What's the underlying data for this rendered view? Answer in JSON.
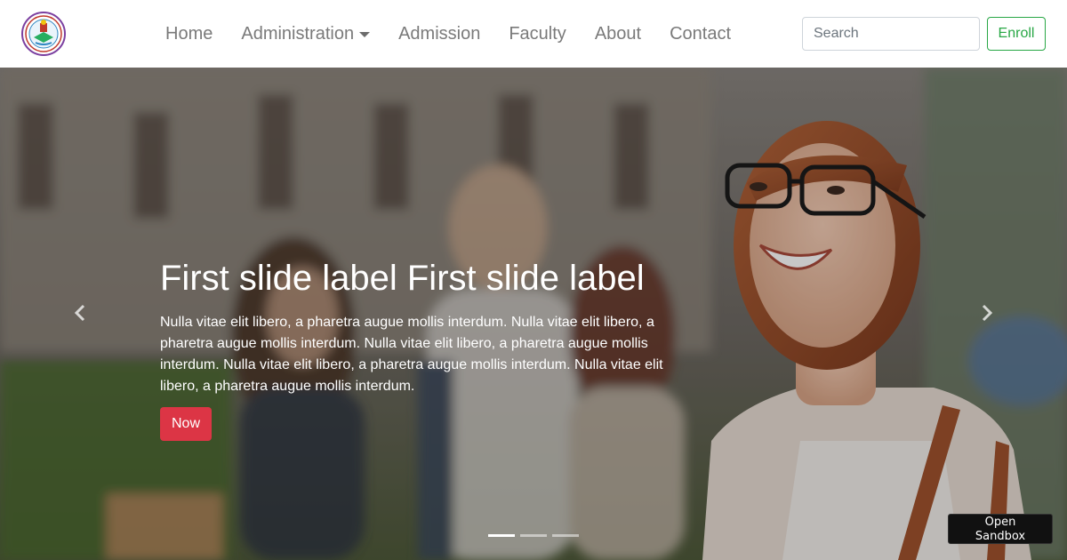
{
  "navbar": {
    "logo": "school-crest-logo",
    "links": [
      {
        "label": "Home"
      },
      {
        "label": "Administration",
        "has_dropdown": true
      },
      {
        "label": "Admission"
      },
      {
        "label": "Faculty"
      },
      {
        "label": "About"
      },
      {
        "label": "Contact"
      }
    ],
    "search": {
      "placeholder": "Search",
      "value": ""
    },
    "enroll_label": "Enroll"
  },
  "carousel": {
    "slide": {
      "title": "First slide label First slide label",
      "text": "Nulla vitae elit libero, a pharetra augue mollis interdum. Nulla vitae elit libero, a pharetra augue mollis interdum. Nulla vitae elit libero, a pharetra augue mollis interdum. Nulla vitae elit libero, a pharetra augue mollis interdum. Nulla vitae elit libero, a pharetra augue mollis interdum.",
      "button_label": "Now"
    },
    "prev_icon": "chevron-left-icon",
    "next_icon": "chevron-right-icon",
    "indicator_count": 3,
    "active_index": 0
  },
  "sandbox_label": "Open Sandbox",
  "colors": {
    "enroll": "#28a745",
    "now_button": "#dc3545",
    "nav_text": "#7a7a7a"
  }
}
